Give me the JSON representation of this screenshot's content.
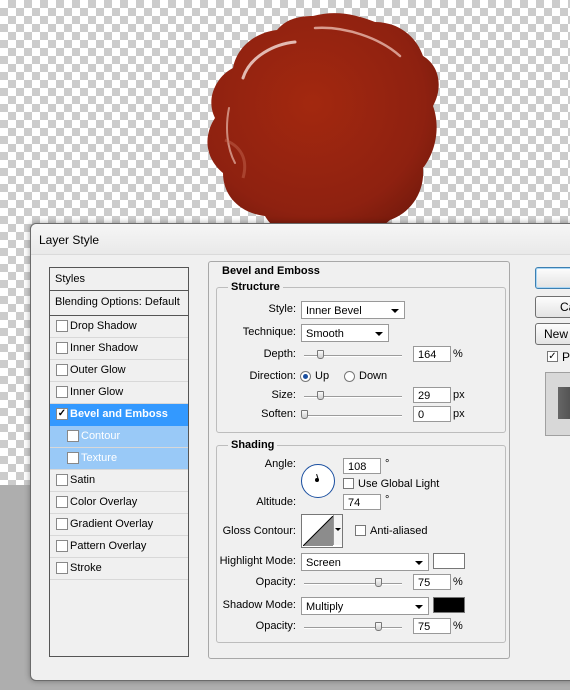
{
  "dialog": {
    "title": "Layer Style",
    "buttons": {
      "ok": "",
      "cancel": "Ca",
      "new_style": "New",
      "preview": "P",
      "preview_checked": true
    }
  },
  "styles_panel": {
    "header": "Styles",
    "blending": "Blending Options: Default",
    "items": [
      {
        "label": "Drop Shadow",
        "checked": false,
        "selected": false,
        "sub": false
      },
      {
        "label": "Inner Shadow",
        "checked": false,
        "selected": false,
        "sub": false
      },
      {
        "label": "Outer Glow",
        "checked": false,
        "selected": false,
        "sub": false
      },
      {
        "label": "Inner Glow",
        "checked": false,
        "selected": false,
        "sub": false
      },
      {
        "label": "Bevel and Emboss",
        "checked": true,
        "selected": true,
        "sub": false
      },
      {
        "label": "Contour",
        "checked": false,
        "selected": false,
        "sub": true
      },
      {
        "label": "Texture",
        "checked": false,
        "selected": false,
        "sub": true
      },
      {
        "label": "Satin",
        "checked": false,
        "selected": false,
        "sub": false
      },
      {
        "label": "Color Overlay",
        "checked": false,
        "selected": false,
        "sub": false
      },
      {
        "label": "Gradient Overlay",
        "checked": false,
        "selected": false,
        "sub": false
      },
      {
        "label": "Pattern Overlay",
        "checked": false,
        "selected": false,
        "sub": false
      },
      {
        "label": "Stroke",
        "checked": false,
        "selected": false,
        "sub": false
      }
    ]
  },
  "bevel": {
    "title": "Bevel and Emboss",
    "structure": {
      "title": "Structure",
      "style_label": "Style:",
      "style_value": "Inner Bevel",
      "technique_label": "Technique:",
      "technique_value": "Smooth",
      "depth_label": "Depth:",
      "depth_value": "164",
      "depth_unit": "%",
      "direction_label": "Direction:",
      "direction_up": "Up",
      "direction_down": "Down",
      "direction_selected": "Up",
      "size_label": "Size:",
      "size_value": "29",
      "size_unit": "px",
      "soften_label": "Soften:",
      "soften_value": "0",
      "soften_unit": "px"
    },
    "shading": {
      "title": "Shading",
      "angle_label": "Angle:",
      "angle_value": "108",
      "angle_unit": "°",
      "global_light_label": "Use Global Light",
      "global_light_checked": false,
      "altitude_label": "Altitude:",
      "altitude_value": "74",
      "altitude_unit": "°",
      "gloss_label": "Gloss Contour:",
      "anti_aliased_label": "Anti-aliased",
      "anti_aliased_checked": false,
      "highlight_label": "Highlight Mode:",
      "highlight_mode": "Screen",
      "highlight_color": "#ffffff",
      "highlight_opacity_label": "Opacity:",
      "highlight_opacity": "75",
      "highlight_opacity_unit": "%",
      "shadow_label": "Shadow Mode:",
      "shadow_mode": "Multiply",
      "shadow_color": "#000000",
      "shadow_opacity_label": "Opacity:",
      "shadow_opacity": "75",
      "shadow_opacity_unit": "%"
    }
  },
  "colors": {
    "selection": "#3399ff",
    "wax": "#8e2110"
  }
}
